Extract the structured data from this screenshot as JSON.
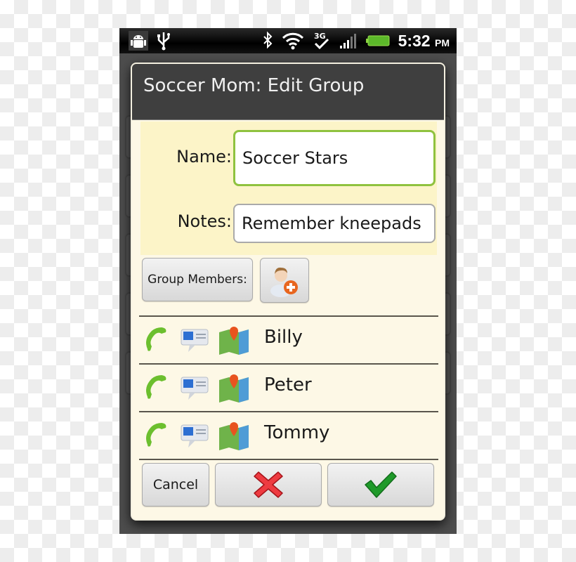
{
  "status_bar": {
    "left_icons": [
      "android-debug-icon",
      "usb-icon"
    ],
    "right_icons": [
      "bluetooth-icon",
      "wifi-icon",
      "3g-data-icon",
      "signal-icon",
      "battery-icon"
    ],
    "network_label": "3G",
    "time": "5:32",
    "ampm": "PM"
  },
  "dialog": {
    "title": "Soccer Mom: Edit Group",
    "name_label": "Name:",
    "name_value": "Soccer Stars",
    "notes_label": "Notes:",
    "notes_value": "Remember kneepads",
    "group_members_button": "Group Members:",
    "add_member_icon": "add-contact-icon",
    "members": [
      {
        "name": "Billy",
        "icons": [
          "phone-icon",
          "message-icon",
          "map-icon"
        ]
      },
      {
        "name": "Peter",
        "icons": [
          "phone-icon",
          "message-icon",
          "map-icon"
        ]
      },
      {
        "name": "Tommy",
        "icons": [
          "phone-icon",
          "message-icon",
          "map-icon"
        ]
      }
    ],
    "cancel_label": "Cancel",
    "delete_icon": "red-x-icon",
    "confirm_icon": "green-check-icon"
  },
  "colors": {
    "focused_input_border": "#8fc23f",
    "dialog_background": "#fdf8e6",
    "form_background": "#fcf4c8",
    "title_bar": "#3f3f3f",
    "delete_red": "#e8262d",
    "confirm_green": "#1f9a2a"
  }
}
